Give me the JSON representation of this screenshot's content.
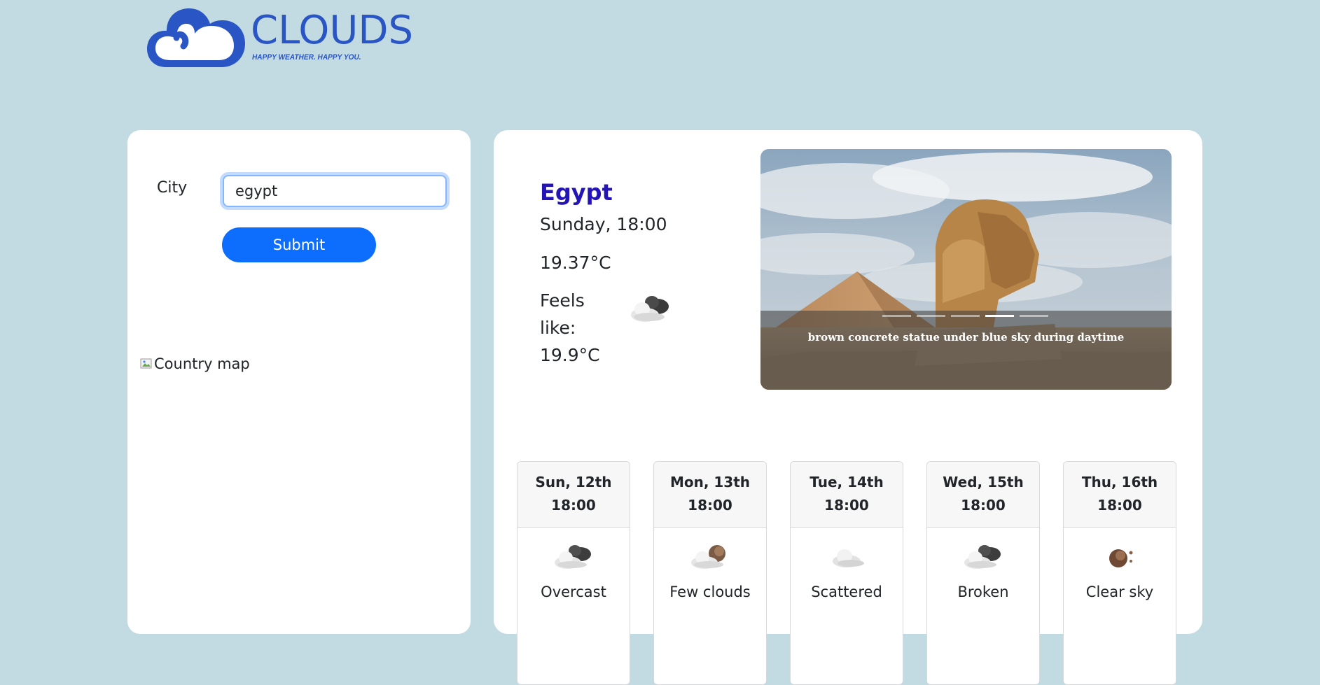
{
  "logo": {
    "word": "CLOUDS",
    "tagline": "HAPPY WEATHER. HAPPY YOU."
  },
  "search": {
    "label": "City",
    "value": "egypt",
    "submit_label": "Submit"
  },
  "map": {
    "alt": "Country map"
  },
  "current": {
    "city": "Egypt",
    "datetime": "Sunday, 18:00",
    "temperature": "19.37°C",
    "feels_like": "Feels like: 19.9°C",
    "icon": "broken-clouds-icon"
  },
  "carousel": {
    "caption": "brown concrete statue under blue sky during daytime",
    "slide_count": 5,
    "active_index": 3
  },
  "forecast": [
    {
      "day": "Sun, 12th",
      "time": "18:00",
      "desc": "Overcast",
      "icon": "overcast-clouds-icon"
    },
    {
      "day": "Mon, 13th",
      "time": "18:00",
      "desc": "Few clouds",
      "icon": "few-clouds-icon"
    },
    {
      "day": "Tue, 14th",
      "time": "18:00",
      "desc": "Scattered",
      "icon": "scattered-clouds-icon"
    },
    {
      "day": "Wed, 15th",
      "time": "18:00",
      "desc": "Broken",
      "icon": "broken-clouds-icon"
    },
    {
      "day": "Thu, 16th",
      "time": "18:00",
      "desc": "Clear sky",
      "icon": "clear-sky-icon"
    }
  ],
  "colors": {
    "page_background": "#c2dbe2",
    "brand_blue": "#2a55c4",
    "city_title": "#2414b8",
    "button_primary": "#0d6efd"
  }
}
